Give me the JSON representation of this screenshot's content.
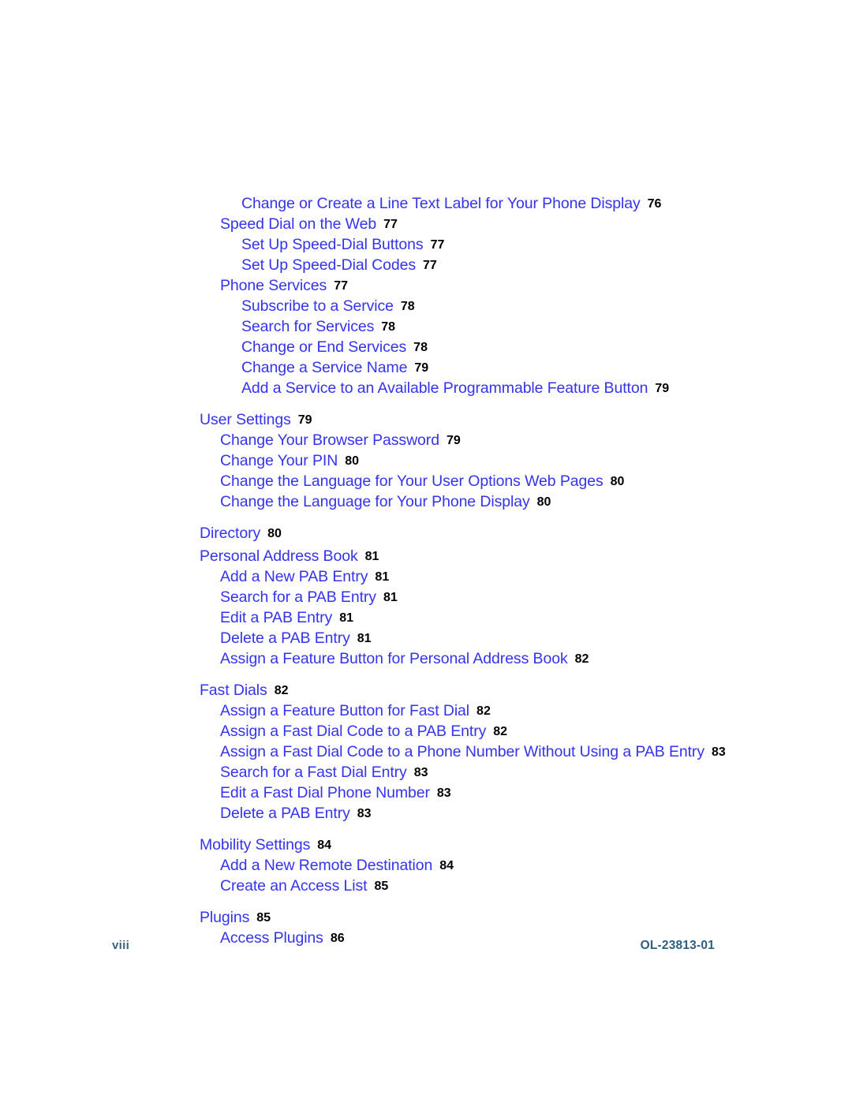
{
  "document": {
    "type": "table-of-contents",
    "colors": {
      "entry_text": "#3333f0",
      "page_number": "#000000",
      "footer_text": "#39617f",
      "background": "#ffffff"
    }
  },
  "toc": {
    "entries": [
      {
        "level": 3,
        "title": "Change or Create a Line Text Label for Your Phone Display",
        "page": "76",
        "spacing": "none"
      },
      {
        "level": 2,
        "title": "Speed Dial on the Web",
        "page": "77",
        "spacing": "none"
      },
      {
        "level": 3,
        "title": "Set Up Speed-Dial Buttons",
        "page": "77",
        "spacing": "none"
      },
      {
        "level": 3,
        "title": "Set Up Speed-Dial Codes",
        "page": "77",
        "spacing": "none"
      },
      {
        "level": 2,
        "title": "Phone Services",
        "page": "77",
        "spacing": "none"
      },
      {
        "level": 3,
        "title": "Subscribe to a Service",
        "page": "78",
        "spacing": "none"
      },
      {
        "level": 3,
        "title": "Search for Services",
        "page": "78",
        "spacing": "none"
      },
      {
        "level": 3,
        "title": "Change or End Services",
        "page": "78",
        "spacing": "none"
      },
      {
        "level": 3,
        "title": "Change a Service Name",
        "page": "79",
        "spacing": "none"
      },
      {
        "level": 3,
        "title": "Add a Service to an Available Programmable Feature Button",
        "page": "79",
        "spacing": "none"
      },
      {
        "level": 1,
        "title": "User Settings",
        "page": "79",
        "spacing": "gap"
      },
      {
        "level": 2,
        "title": "Change Your Browser Password",
        "page": "79",
        "spacing": "none"
      },
      {
        "level": 2,
        "title": "Change Your PIN",
        "page": "80",
        "spacing": "none"
      },
      {
        "level": 2,
        "title": "Change the Language for Your User Options Web Pages",
        "page": "80",
        "spacing": "none"
      },
      {
        "level": 2,
        "title": "Change the Language for Your Phone Display",
        "page": "80",
        "spacing": "none"
      },
      {
        "level": 1,
        "title": "Directory",
        "page": "80",
        "spacing": "gap"
      },
      {
        "level": 1,
        "title": "Personal Address Book",
        "page": "81",
        "spacing": "small"
      },
      {
        "level": 2,
        "title": "Add a New PAB Entry",
        "page": "81",
        "spacing": "none"
      },
      {
        "level": 2,
        "title": "Search for a PAB Entry",
        "page": "81",
        "spacing": "none"
      },
      {
        "level": 2,
        "title": "Edit a PAB Entry",
        "page": "81",
        "spacing": "none"
      },
      {
        "level": 2,
        "title": "Delete a PAB Entry",
        "page": "81",
        "spacing": "none"
      },
      {
        "level": 2,
        "title": "Assign a Feature Button for Personal Address Book",
        "page": "82",
        "spacing": "none"
      },
      {
        "level": 1,
        "title": "Fast Dials",
        "page": "82",
        "spacing": "gap"
      },
      {
        "level": 2,
        "title": "Assign a Feature Button for Fast Dial",
        "page": "82",
        "spacing": "none"
      },
      {
        "level": 2,
        "title": "Assign a Fast Dial Code to a PAB Entry",
        "page": "82",
        "spacing": "none"
      },
      {
        "level": 2,
        "title": "Assign a Fast Dial Code to a Phone Number Without Using a PAB Entry",
        "page": "83",
        "spacing": "none"
      },
      {
        "level": 2,
        "title": "Search for a Fast Dial Entry",
        "page": "83",
        "spacing": "none"
      },
      {
        "level": 2,
        "title": "Edit a Fast Dial Phone Number",
        "page": "83",
        "spacing": "none"
      },
      {
        "level": 2,
        "title": "Delete a PAB Entry",
        "page": "83",
        "spacing": "none"
      },
      {
        "level": 1,
        "title": "Mobility Settings",
        "page": "84",
        "spacing": "gap"
      },
      {
        "level": 2,
        "title": "Add a New Remote Destination",
        "page": "84",
        "spacing": "none"
      },
      {
        "level": 2,
        "title": "Create an Access List",
        "page": "85",
        "spacing": "none"
      },
      {
        "level": 1,
        "title": "Plugins",
        "page": "85",
        "spacing": "gap"
      },
      {
        "level": 2,
        "title": "Access Plugins",
        "page": "86",
        "spacing": "none"
      }
    ]
  },
  "footer": {
    "page_number": "viii",
    "document_id": "OL-23813-01"
  }
}
